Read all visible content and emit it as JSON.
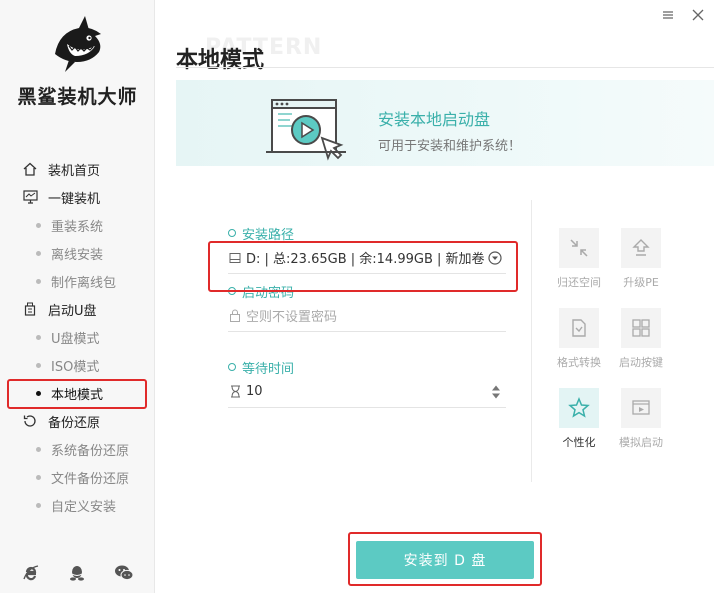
{
  "app": {
    "name": "黑鲨装机大师"
  },
  "window": {
    "minimize": "minimize-icon",
    "close": "close-icon"
  },
  "sidebar": {
    "groups": [
      {
        "label": "装机首页",
        "icon": "home-icon",
        "items": []
      },
      {
        "label": "一键装机",
        "icon": "monitor-icon",
        "items": [
          "重装系统",
          "离线安装",
          "制作离线包"
        ]
      },
      {
        "label": "启动U盘",
        "icon": "usb-icon",
        "items": [
          "U盘模式",
          "ISO模式",
          "本地模式"
        ]
      },
      {
        "label": "备份还原",
        "icon": "backup-icon",
        "items": [
          "系统备份还原",
          "文件备份还原",
          "自定义安装"
        ]
      }
    ],
    "active": "本地模式",
    "bottom_icons": [
      "ie-icon",
      "qq-icon",
      "wechat-icon"
    ]
  },
  "page": {
    "watermark": "PATTERN",
    "title": "本地模式"
  },
  "banner": {
    "title": "安装本地启动盘",
    "subtitle": "可用于安装和维护系统！"
  },
  "form": {
    "path": {
      "label": "安装路径",
      "value": "D: | 总:23.65GB | 余:14.99GB | 新加卷"
    },
    "password": {
      "label": "启动密码",
      "placeholder": "空则不设置密码"
    },
    "wait": {
      "label": "等待时间",
      "value": "10"
    }
  },
  "tools": [
    {
      "label": "归还空间",
      "icon": "shrink-icon",
      "active": false
    },
    {
      "label": "升级PE",
      "icon": "upgrade-icon",
      "active": false
    },
    {
      "label": "格式转换",
      "icon": "convert-icon",
      "active": false
    },
    {
      "label": "启动按键",
      "icon": "keys-icon",
      "active": false
    },
    {
      "label": "个性化",
      "icon": "personalize-icon",
      "active": true
    },
    {
      "label": "模拟启动",
      "icon": "simulate-icon",
      "active": false
    }
  ],
  "install_button": "安装到 D 盘",
  "colors": {
    "accent": "#3ab0aa",
    "button": "#5ccac3",
    "highlight": "#e02a2a"
  }
}
